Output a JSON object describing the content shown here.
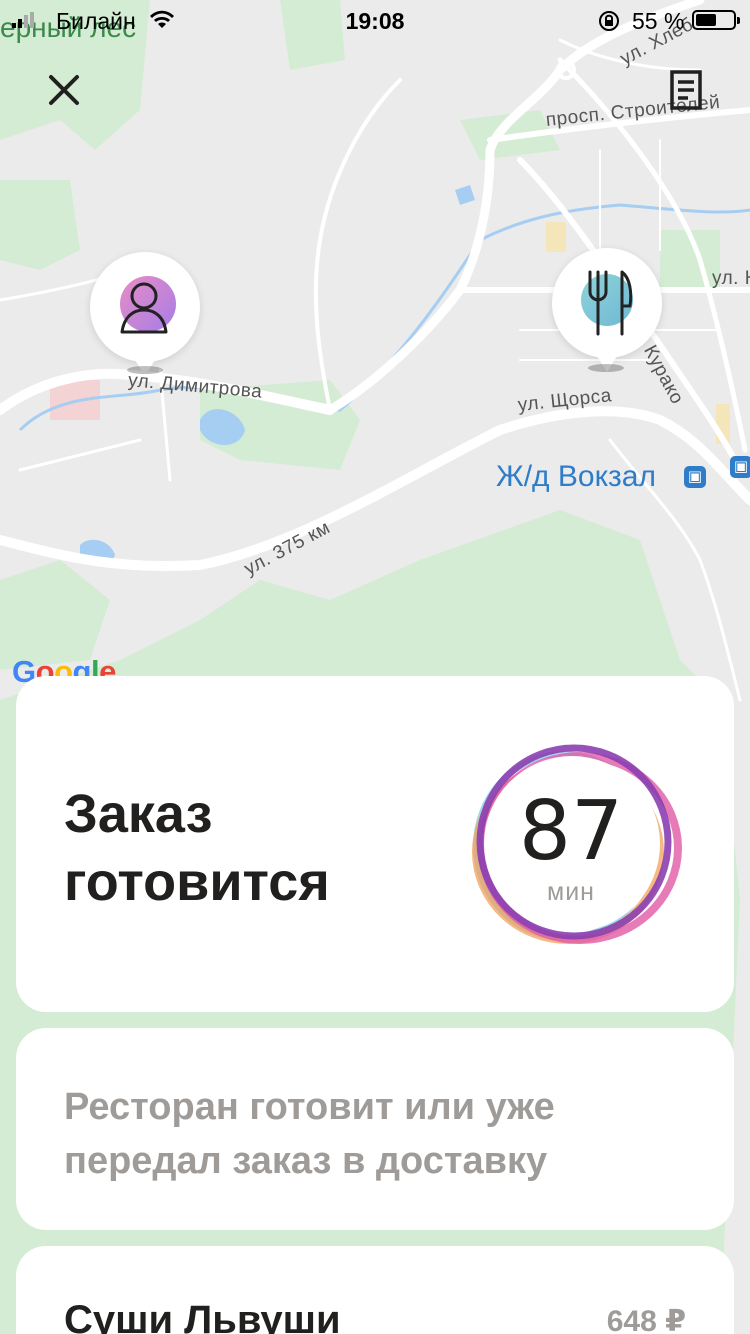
{
  "status_bar": {
    "carrier": "Билайн",
    "time": "19:08",
    "battery": "55 %"
  },
  "map": {
    "labels": {
      "forest": "ерный лес",
      "dimitrova": "ул. Димитрова",
      "shchorsa": "ул. Щорса",
      "km375": "ул. 375 км",
      "stroiteley": "просп. Строителей",
      "khle": "ул. Хлеб",
      "kurako": "Курако",
      "station": "Ж/д Вокзал",
      "ul_k": "ул. К"
    },
    "google_letters": [
      "G",
      "o",
      "o",
      "g",
      "l",
      "e"
    ],
    "colors": {
      "land": "#ebebeb",
      "park": "#d4ecd3",
      "road": "#ffffff",
      "water": "#a6cdf2",
      "station": "#2f7dc9"
    }
  },
  "header": {
    "close_icon": "close-icon",
    "receipt_icon": "receipt-icon"
  },
  "pins": {
    "customer_icon": "user-icon",
    "restaurant_icon": "fork-knife-icon"
  },
  "status_card": {
    "title": "Заказ готовится",
    "timer_value": "87",
    "timer_unit": "мин"
  },
  "info_card": {
    "text": "Ресторан готовит или уже передал заказ в доставку"
  },
  "order_card": {
    "restaurant": "Суши Львуши",
    "price": "648 ₽"
  }
}
